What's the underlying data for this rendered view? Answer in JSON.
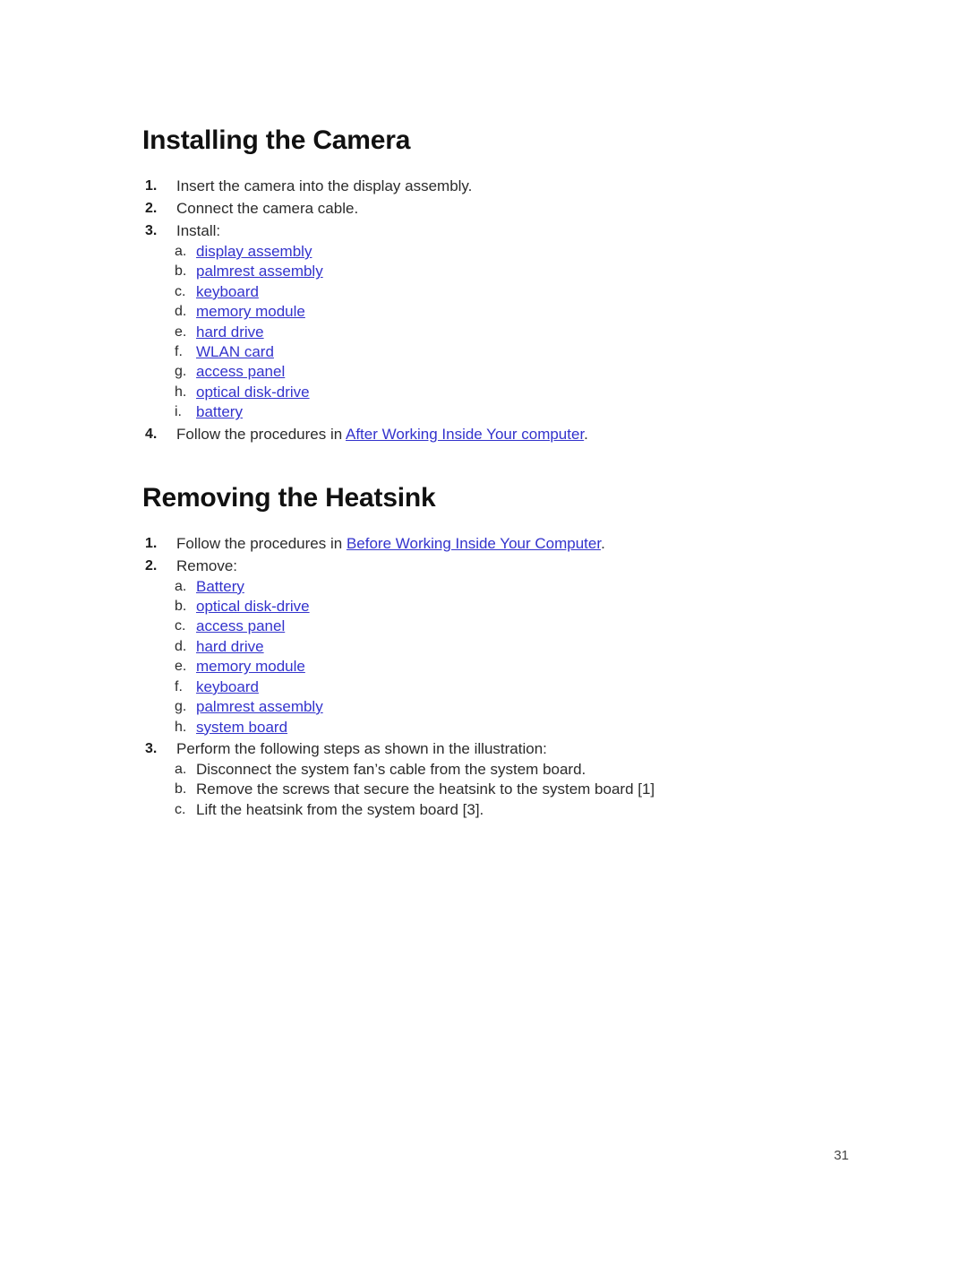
{
  "page": {
    "page_number": "31",
    "link_color": "#3333cc",
    "text_color": "#2b2b2b",
    "heading_color": "#111111",
    "background": "#ffffff"
  },
  "sections": [
    {
      "heading": "Installing the Camera",
      "steps": [
        {
          "marker": "1.",
          "text": "Insert the camera into the display assembly."
        },
        {
          "marker": "2.",
          "text": "Connect the camera cable."
        },
        {
          "marker": "3.",
          "text": "Install:",
          "substeps": [
            {
              "marker": "a.",
              "text": "display assembly",
              "link": true
            },
            {
              "marker": "b.",
              "text": "palmrest assembly",
              "link": true
            },
            {
              "marker": "c.",
              "text": "keyboard",
              "link": true
            },
            {
              "marker": "d.",
              "text": "memory module",
              "link": true
            },
            {
              "marker": "e.",
              "text": "hard drive",
              "link": true
            },
            {
              "marker": "f.",
              "text": "WLAN card",
              "link": true
            },
            {
              "marker": "g.",
              "text": "access panel",
              "link": true
            },
            {
              "marker": "h.",
              "text": "optical disk-drive",
              "link": true
            },
            {
              "marker": "i.",
              "text": "battery",
              "link": true
            }
          ]
        },
        {
          "marker": "4.",
          "text_before": "Follow the procedures in ",
          "link_text": "After Working Inside Your computer",
          "text_after": "."
        }
      ]
    },
    {
      "heading": "Removing the Heatsink",
      "steps": [
        {
          "marker": "1.",
          "text_before": "Follow the procedures in ",
          "link_text": "Before Working Inside Your Computer",
          "text_after": "."
        },
        {
          "marker": "2.",
          "text": "Remove:",
          "substeps": [
            {
              "marker": "a.",
              "text": "Battery",
              "link": true
            },
            {
              "marker": "b.",
              "text": "optical disk-drive",
              "link": true
            },
            {
              "marker": "c.",
              "text": "access panel",
              "link": true
            },
            {
              "marker": "d.",
              "text": "hard drive",
              "link": true
            },
            {
              "marker": "e.",
              "text": "memory module",
              "link": true
            },
            {
              "marker": "f.",
              "text": "keyboard",
              "link": true
            },
            {
              "marker": "g.",
              "text": "palmrest assembly",
              "link": true
            },
            {
              "marker": "h.",
              "text": "system board",
              "link": true
            }
          ]
        },
        {
          "marker": "3.",
          "text": "Perform the following steps as shown in the illustration:",
          "substeps": [
            {
              "marker": "a.",
              "text": "Disconnect the system fan’s cable from the system board.",
              "link": false
            },
            {
              "marker": "b.",
              "text": "Remove the screws that secure the heatsink to the system board [1]",
              "link": false
            },
            {
              "marker": "c.",
              "text": "Lift the heatsink from the system board [3].",
              "link": false
            }
          ]
        }
      ]
    }
  ]
}
